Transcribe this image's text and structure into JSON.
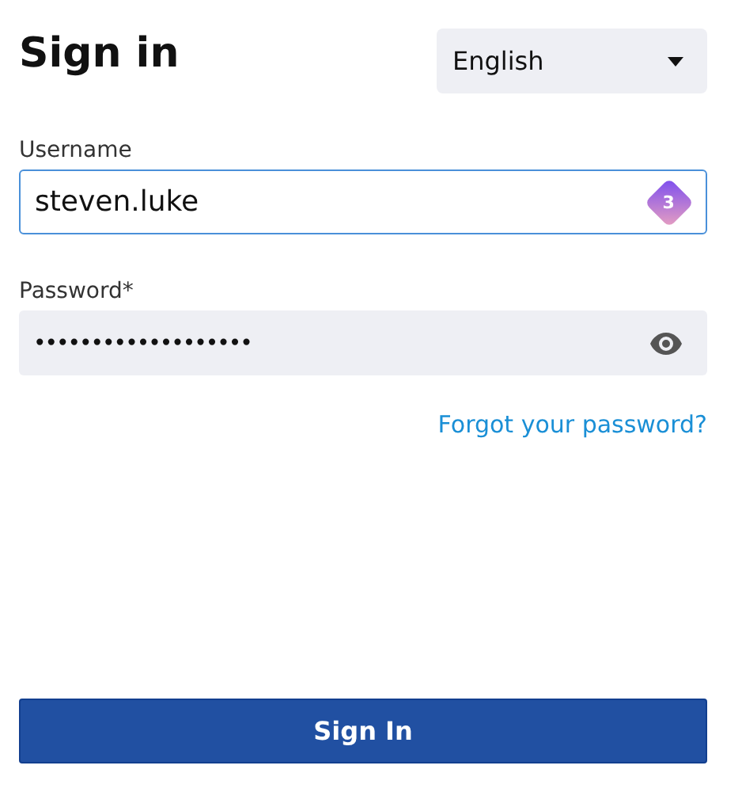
{
  "title": "Sign in",
  "language": {
    "value": "English"
  },
  "username": {
    "label": "Username",
    "value": "steven.luke",
    "badge": "3"
  },
  "password": {
    "label": "Password*",
    "masked_value": "•••••••••••••••••••"
  },
  "forgot_link": "Forgot your password?",
  "submit_button": "Sign In"
}
